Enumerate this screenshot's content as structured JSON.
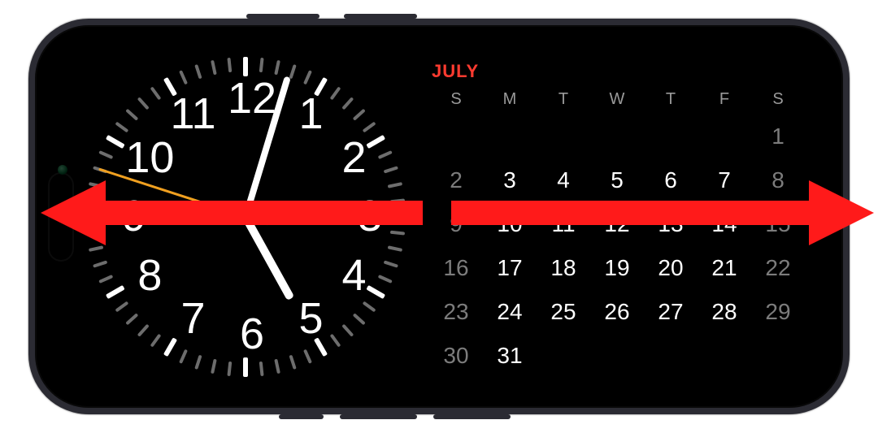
{
  "device": "iphone-landscape-standby",
  "clock": {
    "numerals": [
      "12",
      "1",
      "2",
      "3",
      "4",
      "5",
      "6",
      "7",
      "8",
      "9",
      "10",
      "11"
    ],
    "time": {
      "hour": 5,
      "minute": 2,
      "second": 48
    }
  },
  "calendar": {
    "month_label": "JULY",
    "days_of_week": [
      "S",
      "M",
      "T",
      "W",
      "T",
      "F",
      "S"
    ],
    "weeks": [
      [
        null,
        null,
        null,
        null,
        null,
        null,
        1
      ],
      [
        2,
        3,
        4,
        5,
        6,
        7,
        8
      ],
      [
        9,
        10,
        11,
        12,
        13,
        14,
        15
      ],
      [
        16,
        17,
        18,
        19,
        20,
        21,
        22
      ],
      [
        23,
        24,
        25,
        26,
        27,
        28,
        29
      ],
      [
        30,
        31,
        null,
        null,
        null,
        null,
        null
      ]
    ],
    "today": 31
  },
  "annotation": {
    "left_arrow_color": "#ff1a1a",
    "right_arrow_color": "#ff1a1a"
  }
}
